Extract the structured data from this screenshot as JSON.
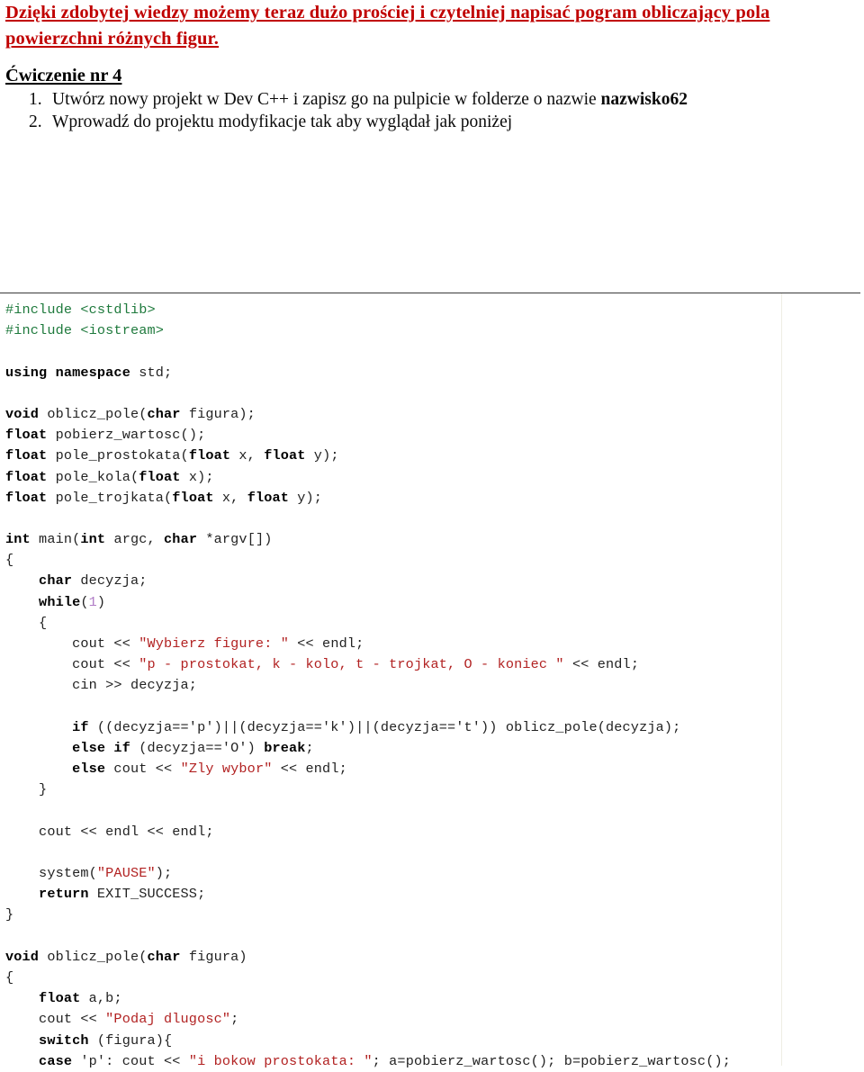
{
  "document": {
    "intro_lines": [
      "Dzięki zdobytej wiedzy możemy teraz dużo prościej i czytelniej napisać pogram obliczający pola",
      "powierzchni różnych figur."
    ],
    "exercise_title": "Ćwiczenie nr 4",
    "steps": [
      {
        "number": "1.",
        "text_before": "Utwórz nowy projekt w Dev C++ i zapisz go na pulpicie w folderze o nazwie ",
        "text_bold": "nazwisko62",
        "text_after": ""
      },
      {
        "number": "2.",
        "text_before": "Wprowadź do projektu modyfikacje tak aby wyglądał jak poniżej",
        "text_bold": "",
        "text_after": ""
      }
    ],
    "colors": {
      "intro_red": "#C00000",
      "code_string_red": "#B22222",
      "code_include_green": "#1F7A3D",
      "code_number_purple": "#B07CC6",
      "rule_gray": "#3a3a3a"
    }
  },
  "code": {
    "language": "C++",
    "lines": [
      [
        {
          "t": "pre",
          "s": "#include <cstdlib>"
        }
      ],
      [
        {
          "t": "pre",
          "s": "#include <iostream>"
        }
      ],
      [
        {
          "t": "plain",
          "s": ""
        }
      ],
      [
        {
          "t": "kw",
          "s": "using namespace"
        },
        {
          "t": "plain",
          "s": " std;"
        }
      ],
      [
        {
          "t": "plain",
          "s": ""
        }
      ],
      [
        {
          "t": "kw",
          "s": "void"
        },
        {
          "t": "plain",
          "s": " oblicz_pole("
        },
        {
          "t": "kw",
          "s": "char"
        },
        {
          "t": "plain",
          "s": " figura);"
        }
      ],
      [
        {
          "t": "kw",
          "s": "float"
        },
        {
          "t": "plain",
          "s": " pobierz_wartosc();"
        }
      ],
      [
        {
          "t": "kw",
          "s": "float"
        },
        {
          "t": "plain",
          "s": " pole_prostokata("
        },
        {
          "t": "kw",
          "s": "float"
        },
        {
          "t": "plain",
          "s": " x, "
        },
        {
          "t": "kw",
          "s": "float"
        },
        {
          "t": "plain",
          "s": " y);"
        }
      ],
      [
        {
          "t": "kw",
          "s": "float"
        },
        {
          "t": "plain",
          "s": " pole_kola("
        },
        {
          "t": "kw",
          "s": "float"
        },
        {
          "t": "plain",
          "s": " x);"
        }
      ],
      [
        {
          "t": "kw",
          "s": "float"
        },
        {
          "t": "plain",
          "s": " pole_trojkata("
        },
        {
          "t": "kw",
          "s": "float"
        },
        {
          "t": "plain",
          "s": " x, "
        },
        {
          "t": "kw",
          "s": "float"
        },
        {
          "t": "plain",
          "s": " y);"
        }
      ],
      [
        {
          "t": "plain",
          "s": ""
        }
      ],
      [
        {
          "t": "kw",
          "s": "int"
        },
        {
          "t": "plain",
          "s": " main("
        },
        {
          "t": "kw",
          "s": "int"
        },
        {
          "t": "plain",
          "s": " argc, "
        },
        {
          "t": "kw",
          "s": "char"
        },
        {
          "t": "plain",
          "s": " *argv[])"
        }
      ],
      [
        {
          "t": "brace",
          "s": "{"
        }
      ],
      [
        {
          "t": "kw",
          "s": "    char"
        },
        {
          "t": "plain",
          "s": " decyzja;"
        }
      ],
      [
        {
          "t": "kw",
          "s": "    while"
        },
        {
          "t": "plain",
          "s": "("
        },
        {
          "t": "num",
          "s": "1"
        },
        {
          "t": "plain",
          "s": ")"
        }
      ],
      [
        {
          "t": "brace",
          "s": "    {"
        }
      ],
      [
        {
          "t": "plain",
          "s": "        cout << "
        },
        {
          "t": "str",
          "s": "\"Wybierz figure: \""
        },
        {
          "t": "plain",
          "s": " << endl;"
        }
      ],
      [
        {
          "t": "plain",
          "s": "        cout << "
        },
        {
          "t": "str",
          "s": "\"p - prostokat, k - kolo, t - trojkat, O - koniec \""
        },
        {
          "t": "plain",
          "s": " << endl;"
        }
      ],
      [
        {
          "t": "plain",
          "s": "        cin >> decyzja;"
        }
      ],
      [
        {
          "t": "plain",
          "s": ""
        }
      ],
      [
        {
          "t": "kw",
          "s": "        if"
        },
        {
          "t": "plain",
          "s": " ((decyzja=='p')||(decyzja=='k')||(decyzja=='t')) oblicz_pole(decyzja);"
        }
      ],
      [
        {
          "t": "kw",
          "s": "        else if"
        },
        {
          "t": "plain",
          "s": " (decyzja=='O') "
        },
        {
          "t": "kw",
          "s": "break"
        },
        {
          "t": "plain",
          "s": ";"
        }
      ],
      [
        {
          "t": "kw",
          "s": "        else"
        },
        {
          "t": "plain",
          "s": " cout << "
        },
        {
          "t": "str",
          "s": "\"Zly wybor\""
        },
        {
          "t": "plain",
          "s": " << endl;"
        }
      ],
      [
        {
          "t": "brace",
          "s": "    }"
        }
      ],
      [
        {
          "t": "plain",
          "s": ""
        }
      ],
      [
        {
          "t": "plain",
          "s": "    cout << endl << endl;"
        }
      ],
      [
        {
          "t": "plain",
          "s": ""
        }
      ],
      [
        {
          "t": "plain",
          "s": "    system("
        },
        {
          "t": "str",
          "s": "\"PAUSE\""
        },
        {
          "t": "plain",
          "s": ");"
        }
      ],
      [
        {
          "t": "kw",
          "s": "    return"
        },
        {
          "t": "plain",
          "s": " EXIT_SUCCESS;"
        }
      ],
      [
        {
          "t": "brace",
          "s": "}"
        }
      ],
      [
        {
          "t": "plain",
          "s": ""
        }
      ],
      [
        {
          "t": "kw",
          "s": "void"
        },
        {
          "t": "plain",
          "s": " oblicz_pole("
        },
        {
          "t": "kw",
          "s": "char"
        },
        {
          "t": "plain",
          "s": " figura)"
        }
      ],
      [
        {
          "t": "brace",
          "s": "{"
        }
      ],
      [
        {
          "t": "kw",
          "s": "    float"
        },
        {
          "t": "plain",
          "s": " a,b;"
        }
      ],
      [
        {
          "t": "plain",
          "s": "    cout << "
        },
        {
          "t": "str",
          "s": "\"Podaj dlugosc\""
        },
        {
          "t": "plain",
          "s": ";"
        }
      ],
      [
        {
          "t": "kw",
          "s": "    switch"
        },
        {
          "t": "plain",
          "s": " (figura){"
        }
      ],
      [
        {
          "t": "kw",
          "s": "    case"
        },
        {
          "t": "plain",
          "s": " 'p': cout << "
        },
        {
          "t": "str",
          "s": "\"i bokow prostokata: \""
        },
        {
          "t": "plain",
          "s": "; a=pobierz_wartosc(); b=pobierz_wartosc();"
        }
      ]
    ]
  }
}
